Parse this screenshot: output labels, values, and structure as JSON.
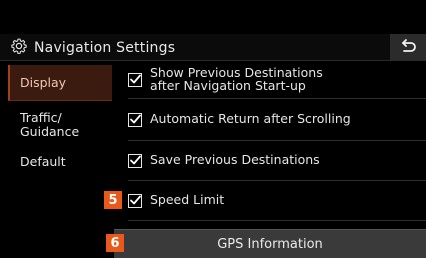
{
  "header": {
    "title": "Navigation Settings",
    "title_icon": "gear-icon",
    "back_icon": "back-arrow-icon"
  },
  "sidebar": {
    "items": [
      {
        "label": "Display",
        "active": true
      },
      {
        "label": "Traffic/\nGuidance",
        "active": false
      },
      {
        "label": "Default",
        "active": false
      }
    ]
  },
  "settings": {
    "items": [
      {
        "label": "Show Previous Destinations\nafter Navigation Start-up",
        "checked": true
      },
      {
        "label": "Automatic Return after Scrolling",
        "checked": true
      },
      {
        "label": "Save Previous Destinations",
        "checked": true
      },
      {
        "label": "Speed Limit",
        "checked": true
      }
    ]
  },
  "callouts": {
    "speed_limit": "5",
    "gps_information": "6"
  },
  "buttons": {
    "gps_information": "GPS Information"
  },
  "colors": {
    "accent": "#e8591b",
    "active_tab_bg": "#3b1a10"
  }
}
